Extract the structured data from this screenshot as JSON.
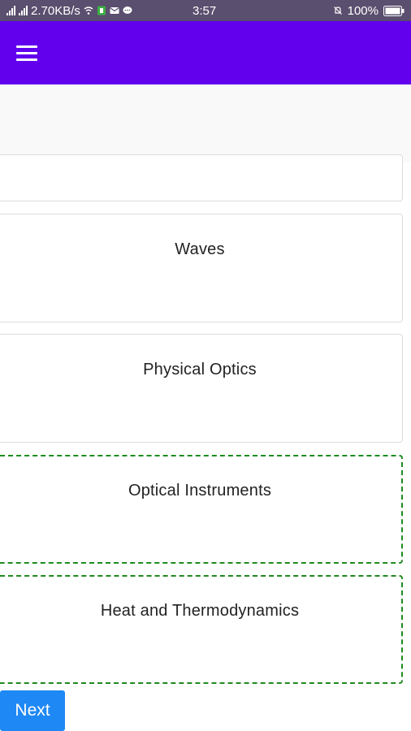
{
  "status_bar": {
    "network_speed": "2.70KB/s",
    "time": "3:57",
    "battery": "100%"
  },
  "app_bar": {
    "menu_icon": "hamburger-menu-icon",
    "color": "#6200ee"
  },
  "topics": [
    {
      "label": ""
    },
    {
      "label": "Waves"
    },
    {
      "label": "Physical Optics"
    },
    {
      "label": "Optical Instruments"
    },
    {
      "label": "Heat and Thermodynamics"
    }
  ],
  "actions": {
    "next_label": "Next"
  },
  "colors": {
    "accent": "#1e88f5",
    "dashed_border": "#1f8a1f"
  }
}
